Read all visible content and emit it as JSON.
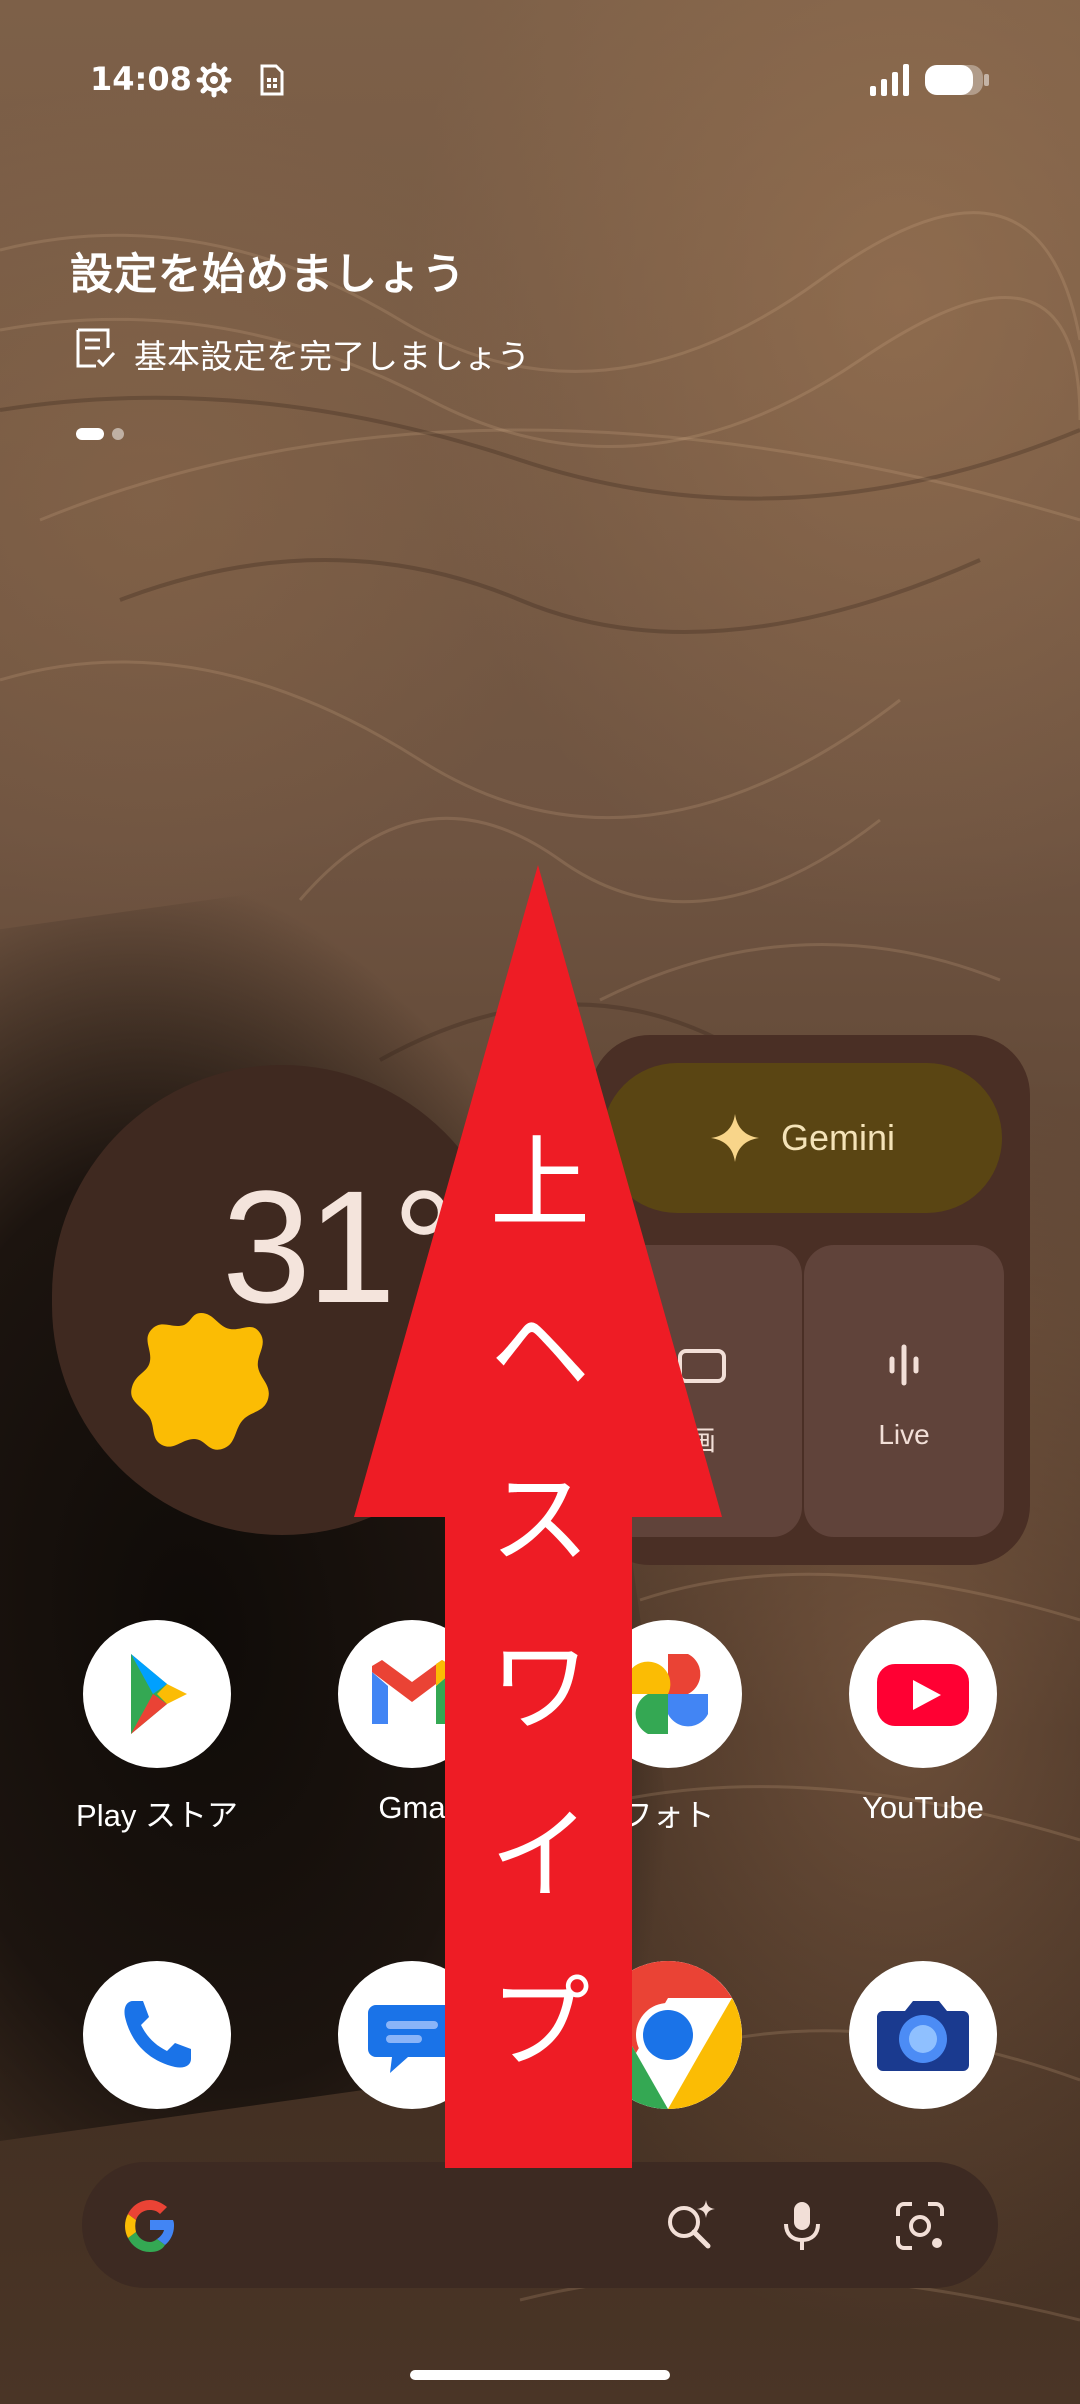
{
  "status_bar": {
    "time": "14:08",
    "icons": [
      "gear-icon",
      "sim-card-icon",
      "signal-icon",
      "battery-icon"
    ]
  },
  "setup_card": {
    "title": "設定を始めましょう",
    "subtitle": "基本設定を完了しましょう",
    "icon": "checklist-icon",
    "pager": {
      "pages": 2,
      "current": 1
    }
  },
  "weather": {
    "temperature": "31°",
    "condition_icon": "sun-icon"
  },
  "gemini_widget": {
    "main_label": "Gemini",
    "tiles": [
      {
        "label": "画",
        "icon": "camera-icon"
      },
      {
        "label": "Live",
        "icon": "live-waveform-icon"
      }
    ]
  },
  "apps_row1": [
    {
      "label": "Play ストア",
      "icon": "play-store-icon"
    },
    {
      "label": "Gma",
      "icon": "gmail-icon"
    },
    {
      "label": "フォト",
      "icon": "photos-icon"
    },
    {
      "label": "YouTube",
      "icon": "youtube-icon"
    }
  ],
  "apps_row2": [
    {
      "icon": "phone-icon"
    },
    {
      "icon": "messages-icon"
    },
    {
      "icon": "chrome-icon"
    },
    {
      "icon": "camera-app-icon"
    }
  ],
  "search_bar": {
    "icons": [
      "google-g-icon",
      "ai-search-icon",
      "microphone-icon",
      "lens-icon"
    ]
  },
  "overlay": {
    "text": [
      "上",
      "ヘ",
      "ス",
      "ワ",
      "イ",
      "プ"
    ],
    "color": "#ee1c25"
  },
  "colors": {
    "weather_bg": "#3f2920",
    "gemini_bg": "#4a2f25",
    "gemini_button": "#5a4513",
    "searchbar_bg": "#3d2a22"
  }
}
